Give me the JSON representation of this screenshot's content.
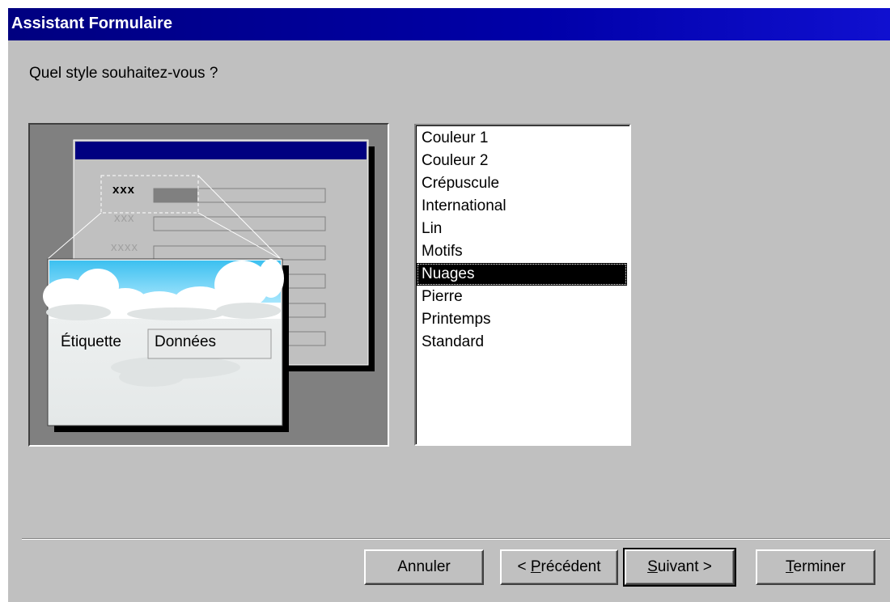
{
  "window": {
    "title": "Assistant Formulaire"
  },
  "prompt": "Quel style souhaitez-vous ?",
  "preview": {
    "sample_labels": [
      "xxx",
      "xxx",
      "xxxx"
    ],
    "label_text": "Étiquette",
    "data_text": "Données"
  },
  "styles_list": {
    "items": [
      "Couleur 1",
      "Couleur 2",
      "Crépuscule",
      "International",
      "Lin",
      "Motifs",
      "Nuages",
      "Pierre",
      "Printemps",
      "Standard"
    ],
    "selected": "Nuages"
  },
  "buttons": {
    "cancel": "Annuler",
    "previous_prefix": "< ",
    "previous_mnemonic": "P",
    "previous_rest": "récédent",
    "next_mnemonic": "S",
    "next_rest": "uivant >",
    "finish_mnemonic": "T",
    "finish_rest": "erminer"
  },
  "colors": {
    "dialog_bg": "#c0c0c0",
    "title_bar": "#000080",
    "selection": "#000000"
  }
}
